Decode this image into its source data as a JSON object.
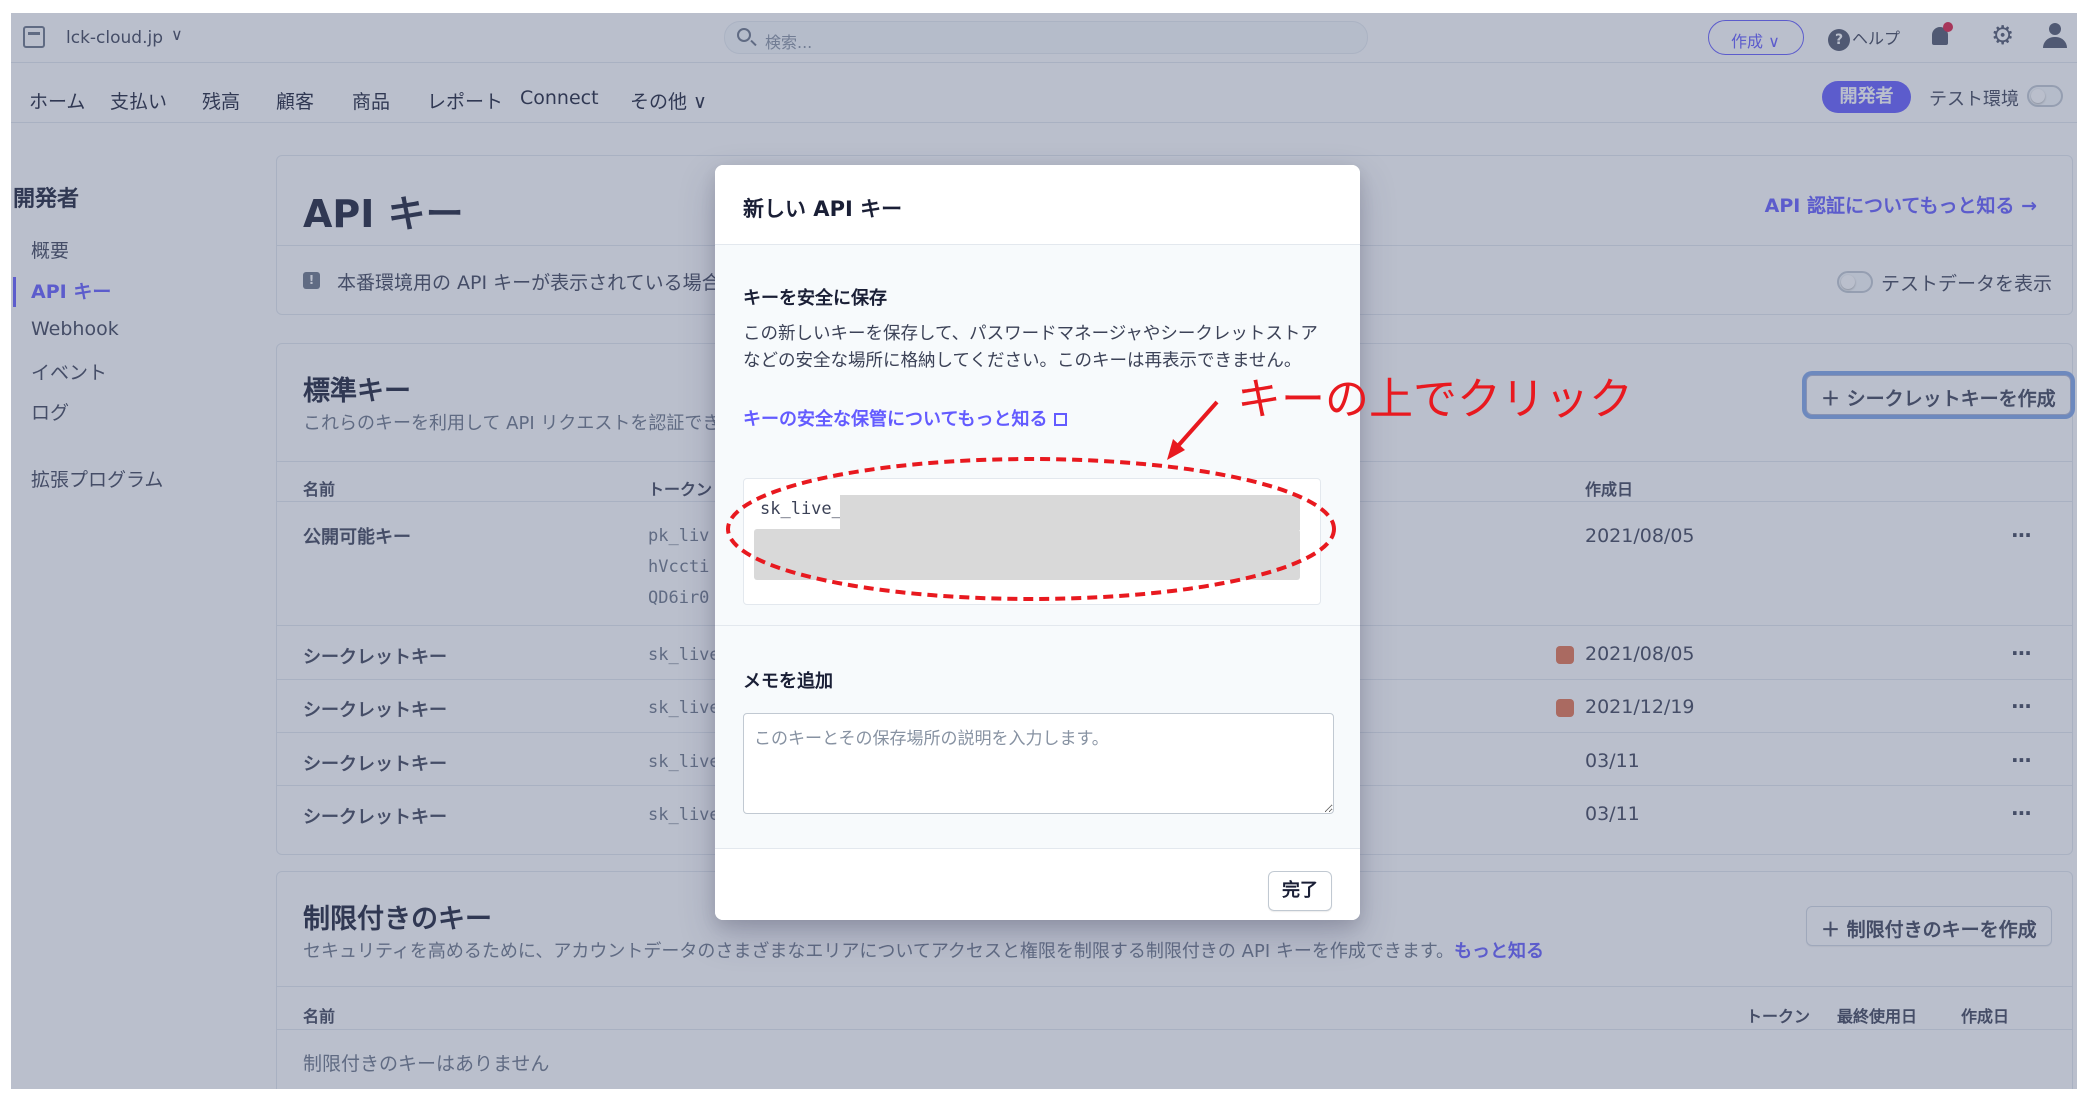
{
  "topbar": {
    "account_name": "lck-cloud.jp",
    "search_placeholder": "検索...",
    "create_label": "作成 ∨",
    "help_label": "ヘルプ"
  },
  "nav": {
    "items": [
      "ホーム",
      "支払い",
      "残高",
      "顧客",
      "商品",
      "レポート",
      "Connect",
      "その他 ∨"
    ],
    "developer_label": "開発者",
    "test_env_label": "テスト環境"
  },
  "sidebar": {
    "title": "開発者",
    "items": [
      "概要",
      "API キー",
      "Webhook",
      "イベント",
      "ログ",
      "拡張プログラム"
    ]
  },
  "page": {
    "title": "API キー",
    "learn_link": "API 認証についてもっと知る →",
    "info_text": "本番環境用の API キーが表示されている場合は",
    "test_data_label": "テストデータを表示"
  },
  "standard_keys": {
    "title": "標準キー",
    "description": "これらのキーを利用して API リクエストを認証できます。",
    "create_button": "＋ シークレットキーを作成",
    "headers": {
      "name": "名前",
      "token": "トークン",
      "created": "作成日"
    },
    "rows": [
      {
        "name": "公開可能キー",
        "token": [
          "pk_liv",
          "hVccti",
          "QD6ir0"
        ],
        "created": "2021/08/05",
        "warn": false
      },
      {
        "name": "シークレットキー",
        "token": [
          "sk_live"
        ],
        "created": "2021/08/05",
        "warn": true
      },
      {
        "name": "シークレットキー",
        "token": [
          "sk_live"
        ],
        "created": "2021/12/19",
        "warn": true
      },
      {
        "name": "シークレットキー",
        "token": [
          "sk_live"
        ],
        "created": "03/11",
        "warn": false
      },
      {
        "name": "シークレットキー",
        "token": [
          "sk_live"
        ],
        "created": "03/11",
        "warn": false
      }
    ],
    "more_label": "···"
  },
  "restricted_keys": {
    "title": "制限付きのキー",
    "description": "セキュリティを高めるために、アカウントデータのさまざまなエリアについてアクセスと権限を制限する制限付きの API キーを作成できます。",
    "learn_more": "もっと知る",
    "create_button": "＋ 制限付きのキーを作成",
    "headers": {
      "name": "名前",
      "token": "トークン",
      "last_used": "最終使用日",
      "created": "作成日"
    },
    "empty": "制限付きのキーはありません"
  },
  "modal": {
    "title": "新しい API キー",
    "subtitle": "キーを安全に保存",
    "description": "この新しいキーを保存して、パスワードマネージャやシークレットストアなどの安全な場所に格納してください。このキーは再表示できません。",
    "learn_link": "キーの安全な保管についてもっと知る",
    "key_prefix": "sk_live_",
    "memo_label": "メモを追加",
    "memo_placeholder": "このキーとその保存場所の説明を入力します。",
    "done_button": "完了"
  },
  "annotation": {
    "text": "キーの上でクリック",
    "color": "#e8191f"
  },
  "colors": {
    "accent": "#635bff",
    "warning": "#e5724d"
  }
}
